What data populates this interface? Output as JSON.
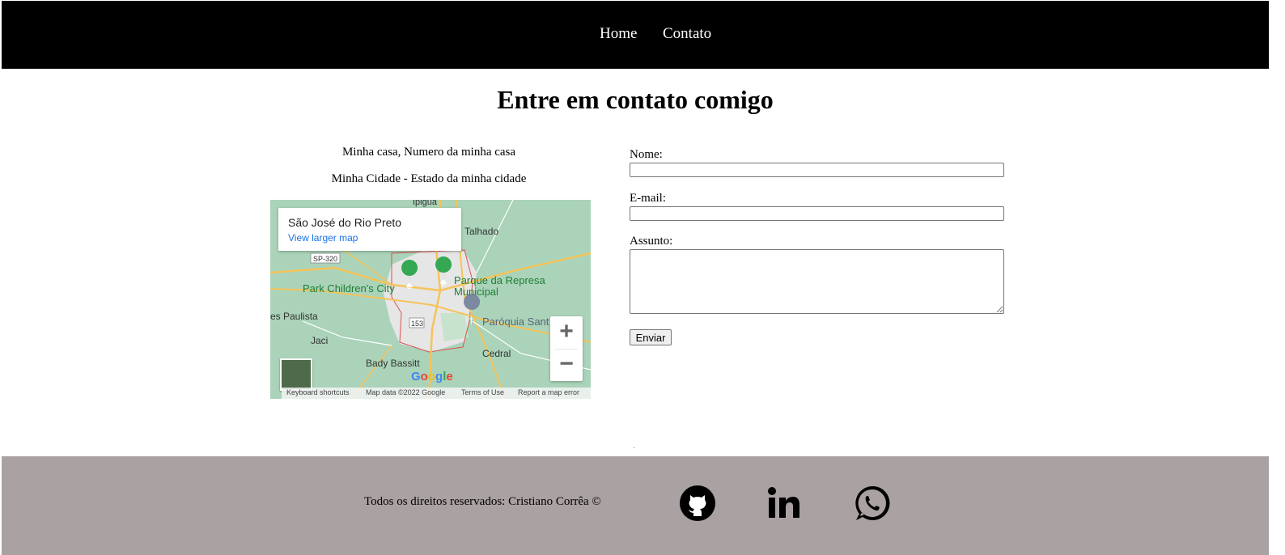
{
  "nav": {
    "home": "Home",
    "contato": "Contato"
  },
  "page": {
    "title": "Entre em contato comigo"
  },
  "address": {
    "line1": "Minha casa, Numero da minha casa",
    "line2": "Minha Cidade - Estado da minha cidade"
  },
  "map": {
    "place": "São José do Rio Preto",
    "larger_link": "View larger map",
    "labels": {
      "ipigua": "Ipiguá",
      "talhado": "Talhado",
      "sp320": "SP-320",
      "park": "Park Children's City",
      "parque1": "Parque da Represa",
      "parque2": "Municipal",
      "paulista": "es Paulista",
      "road153": "153",
      "paroquia": "Paróquia Sant",
      "jaci": "Jaci",
      "cedral": "Cedral",
      "bady": "Bady Bassitt"
    },
    "zoom_in": "+",
    "zoom_out": "−",
    "google": "Google",
    "attribution": {
      "shortcuts": "Keyboard shortcuts",
      "data": "Map data ©2022 Google",
      "terms": "Terms of Use",
      "report": "Report a map error"
    },
    "colors": {
      "land": "#aad3b9",
      "urban": "#e8e8e8",
      "road": "#f5c35a",
      "border": "#d9534f",
      "park_pin": "#34a853"
    }
  },
  "form": {
    "name_label": "Nome:",
    "name_value": "",
    "email_label": "E-mail:",
    "email_value": "",
    "subject_label": "Assunto:",
    "subject_value": "",
    "submit": "Enviar"
  },
  "footer": {
    "copyright": "Todos os direitos reservados: Cristiano Corrêa ©",
    "social": [
      "github-icon",
      "linkedin-icon",
      "whatsapp-icon"
    ],
    "background": "#a9a1a2"
  },
  "colors": {
    "header_bg": "#000000",
    "header_text": "#ffffff"
  }
}
